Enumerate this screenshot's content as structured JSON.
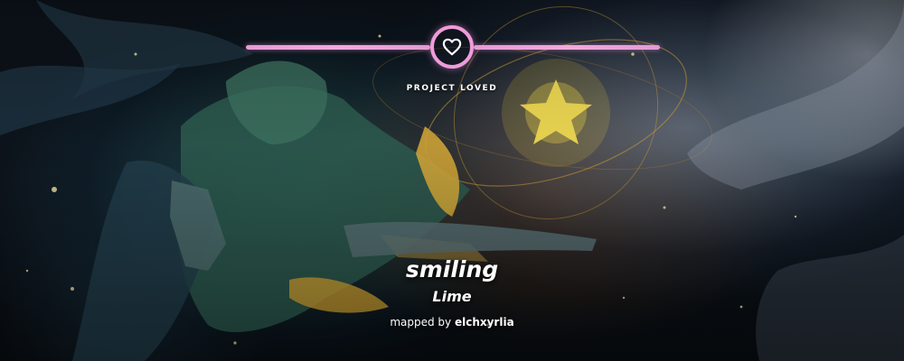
{
  "banner": {
    "section_label": "PROJECT LOVED",
    "status_icon": "heart-icon",
    "accent_color": "#ee9cd9"
  },
  "beatmap": {
    "title": "smiling",
    "artist": "Lime",
    "mapped_by_prefix": "mapped by",
    "mapper": "elchxyrlia"
  }
}
